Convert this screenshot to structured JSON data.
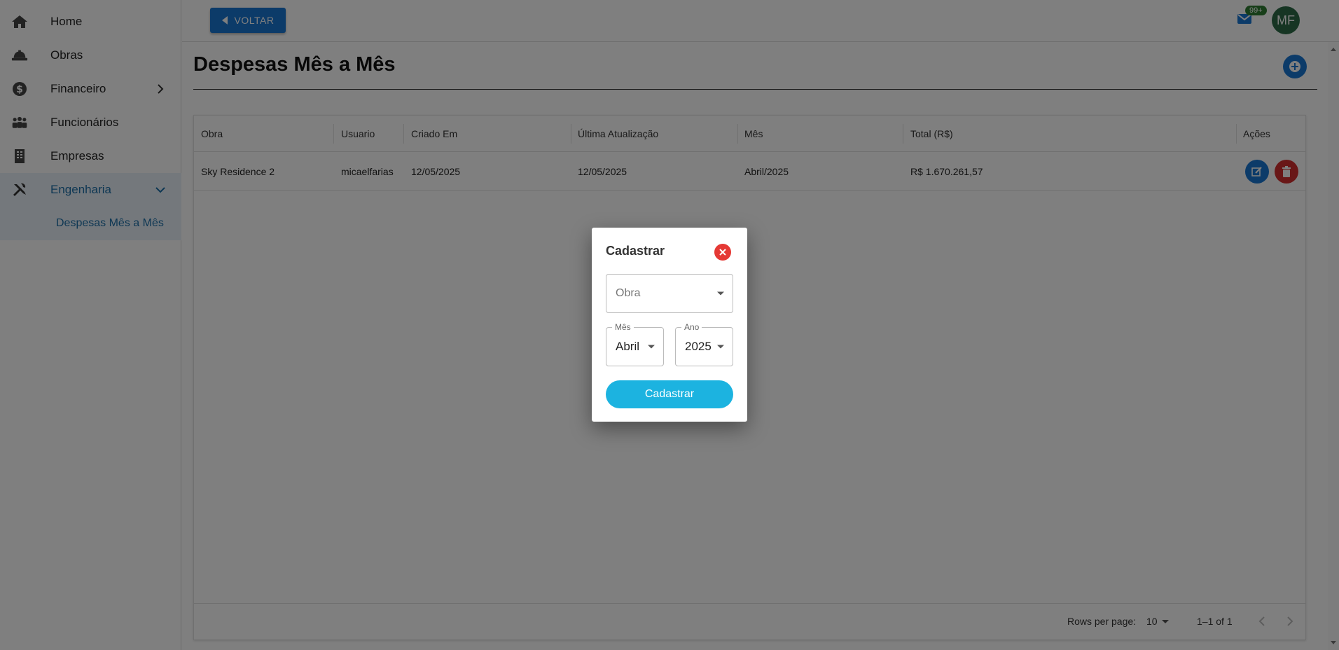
{
  "sidebar": {
    "items": [
      {
        "label": "Home",
        "icon": "home-icon"
      },
      {
        "label": "Obras",
        "icon": "hard-hat-icon"
      },
      {
        "label": "Financeiro",
        "icon": "dollar-icon"
      },
      {
        "label": "Funcionários",
        "icon": "people-icon"
      },
      {
        "label": "Empresas",
        "icon": "building-icon"
      },
      {
        "label": "Engenharia",
        "icon": "tools-icon"
      }
    ],
    "sub_items": [
      {
        "label": "Despesas Mês a Mês"
      }
    ]
  },
  "topbar": {
    "back_label": "VOLTAR",
    "mail_badge": "99+",
    "avatar_initials": "MF"
  },
  "page": {
    "title": "Despesas Mês a Mês"
  },
  "table": {
    "columns": [
      "Obra",
      "Usuario",
      "Criado Em",
      "Última Atualização",
      "Mês",
      "Total (R$)",
      "Ações"
    ],
    "rows": [
      {
        "obra": "Sky Residence 2",
        "usuario": "micaelfarias",
        "criado_em": "12/05/2025",
        "ultima_atualizacao": "12/05/2025",
        "mes": "Abril/2025",
        "total": "R$ 1.670.261,57"
      }
    ],
    "footer": {
      "rows_per_page_label": "Rows per page:",
      "rows_per_page_value": "10",
      "range": "1–1 of 1"
    }
  },
  "modal": {
    "title": "Cadastrar",
    "obra_placeholder": "Obra",
    "mes_label": "Mês",
    "mes_value": "Abril",
    "ano_label": "Ano",
    "ano_value": "2025",
    "submit_label": "Cadastrar"
  },
  "colors": {
    "primary": "#1976d2",
    "danger": "#d32f2f",
    "submit": "#1cb3e0",
    "active_nav": "#1d6fa8"
  }
}
